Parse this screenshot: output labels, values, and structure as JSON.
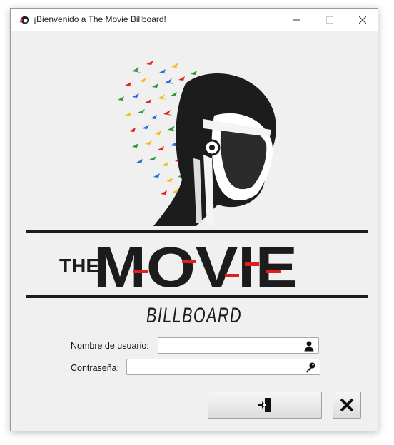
{
  "window": {
    "title": "¡Bienvenido a The Movie Billboard!"
  },
  "logo": {
    "line1": "THE",
    "line2": "MOVIE",
    "line3": "BILLBOARD"
  },
  "form": {
    "username_label": "Nombre de usuario:",
    "username_value": "",
    "password_label": "Contraseña:",
    "password_value": ""
  },
  "icons": {
    "app": "chief-icon",
    "user": "user-icon",
    "password": "key-icon",
    "login": "sign-in-icon",
    "exit": "close-x-icon"
  }
}
